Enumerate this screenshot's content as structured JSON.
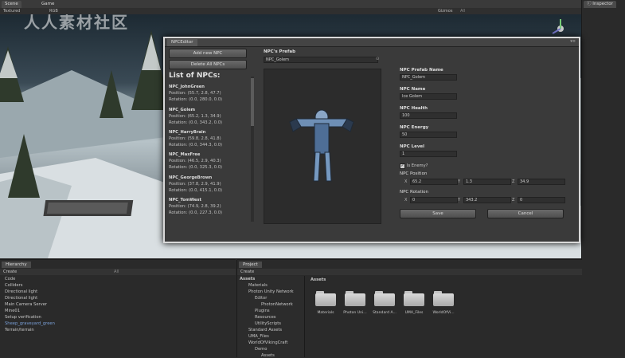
{
  "tabs": {
    "scene": "Scene",
    "game": "Game",
    "inspector": "Inspector"
  },
  "scene_toolbar": {
    "shading": "Textured",
    "mode": "RGB",
    "gizmos": "Gizmos",
    "search": "All"
  },
  "watermark": "人人素材社区",
  "editor": {
    "tab": "NPCEditor",
    "add_button": "Add new NPC",
    "delete_button": "Delete All NPCs",
    "list_heading": "List of NPCs:",
    "npcs": [
      {
        "name": "NPC_JohnGreen",
        "position": "Position: (55.7, 2.8, 47.7)",
        "rotation": "Rotation: (0.0, 280.0, 0.0)"
      },
      {
        "name": "NPC_Golem",
        "position": "Position: (65.2, 1.3, 34.9)",
        "rotation": "Rotation: (0.0, 343.2, 0.0)"
      },
      {
        "name": "NPC_HarryBrain",
        "position": "Position: (59.8, 2.8, 41.8)",
        "rotation": "Rotation: (0.0, 344.3, 0.0)"
      },
      {
        "name": "NPC_MaxFree",
        "position": "Position: (46.5, 2.9, 40.3)",
        "rotation": "Rotation: (0.0, 325.3, 0.0)"
      },
      {
        "name": "NPC_GeorgeBrown",
        "position": "Position: (37.8, 2.9, 41.9)",
        "rotation": "Rotation: (0.0, 415.1, 0.0)"
      },
      {
        "name": "NPC_TomWest",
        "position": "Position: (74.9, 2.8, 39.2)",
        "rotation": "Rotation: (0.0, 227.3, 0.0)"
      }
    ],
    "prefab_label": "NPC's Prefab",
    "prefab_value": "NPC_Golem",
    "fields": {
      "prefab_name_label": "NPC Prefab Name",
      "prefab_name_value": "NPC_Golem",
      "name_label": "NPC Name",
      "name_value": "Ice Golem",
      "health_label": "NPC Health",
      "health_value": "100",
      "energy_label": "NPC Energy",
      "energy_value": "50",
      "level_label": "NPC Level",
      "level_value": "1",
      "enemy_label": "Is Enemy?",
      "position_label": "NPC Position",
      "position": {
        "x_label": "X",
        "x": "65.2",
        "y_label": "Y",
        "y": "1.3",
        "z_label": "Z",
        "z": "34.9"
      },
      "rotation_label": "NPC Rotation",
      "rotation": {
        "x_label": "X",
        "x": "0",
        "y_label": "Y",
        "y": "343.2",
        "z_label": "Z",
        "z": "0"
      }
    },
    "save_button": "Save",
    "cancel_button": "Cancel"
  },
  "hierarchy": {
    "tab": "Hierarchy",
    "create": "Create",
    "search": "All",
    "items": [
      "Code",
      "Colliders",
      "Directional light",
      "Directional light",
      "Main Camera Server",
      "Mine01",
      "Setup verification",
      "Sheep_graveyard_green",
      "Terrain/terrain"
    ]
  },
  "project": {
    "tab": "Project",
    "create": "Create",
    "tree": [
      "Assets",
      "Materials",
      "Photon Unity Network",
      "Editor",
      "PhotonNetwork",
      "Plugins",
      "Resources",
      "UtilityScripts",
      "Standard Assets",
      "UMA_Files",
      "WorldOfVikingCraft",
      "Demo",
      "Assets"
    ],
    "breadcrumb": "Assets",
    "folders": [
      "Materials",
      "Photon Uni...",
      "Standard A...",
      "UMA_Files",
      "WorldOfVi..."
    ]
  }
}
